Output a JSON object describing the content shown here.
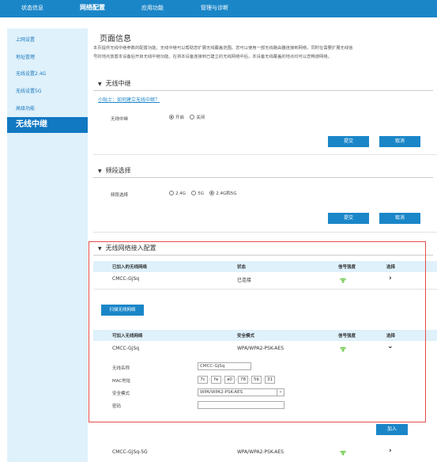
{
  "nav": {
    "items": [
      "状态信息",
      "网络配置",
      "应用功能",
      "管理与诊断"
    ]
  },
  "sidebar": {
    "items": [
      "上网设置",
      "地址管理",
      "无线设置2.4G",
      "无线设置5G",
      "高级功能",
      "无线中继"
    ]
  },
  "page": {
    "title": "页面信息",
    "desc_line1": "本页提供无线中继参数的配置功能。无线中继可以帮助您扩展无线覆盖范围。您可以使用一部无线路由器连接到网络，同时在需要扩展无线信",
    "desc_line2": "号的地点放置本设备后开启无线中继功能。在将本设备连接到已建立的无线网络中后，本设备无线覆盖的地点均可以您畅游网络。"
  },
  "relay": {
    "section_title": "无线中继",
    "tip_link": "小贴士：如何建立无线中继？",
    "label": "无线中继",
    "opt_on": "开启",
    "opt_off": "关闭",
    "selected": "开启",
    "submit": "提交",
    "cancel": "取消"
  },
  "band": {
    "section_title": "频段选择",
    "label": "频段选择",
    "opts": [
      "2.4G",
      "5G",
      "2.4G和5G"
    ],
    "selected": "2.4G和5G",
    "submit": "提交",
    "cancel": "取消"
  },
  "access": {
    "section_title": "无线网络接入配置",
    "joined_headers": [
      "已加入的无线网络",
      "状态",
      "信号强度",
      "选择"
    ],
    "joined_rows": [
      {
        "ssid": "CMCC-GjSq",
        "status": "已连接"
      }
    ],
    "scan_button": "扫描无线网络",
    "avail_headers": [
      "可加入无线网络",
      "安全模式",
      "信号强度",
      "选择"
    ],
    "avail_rows": [
      {
        "ssid": "CMCC-GjSq",
        "security": "WPA/WPA2-PSK-AES"
      },
      {
        "ssid": "CMCC-GjSq-5G",
        "security": "WPA/WPA2-PSK-AES"
      }
    ],
    "form": {
      "ssid_label": "无线名称",
      "ssid_value": "CMCC-GjSq",
      "mac_label": "MAC地址",
      "mac": [
        "7c",
        "fa",
        "a0",
        "78",
        "5b",
        "31"
      ],
      "security_label": "安全模式",
      "security_value": "WPA/WPA2-PSK-AES",
      "password_label": "密码",
      "password_value": ""
    },
    "add_button": "加入"
  },
  "colors": {
    "nav_bg": "#1a86c8",
    "sidebar_bg": "#dff1fb",
    "active_item": "#1178c2",
    "button": "#1a86c8",
    "wifi": "#45b91a",
    "highlight_box": "#e64b4b"
  }
}
